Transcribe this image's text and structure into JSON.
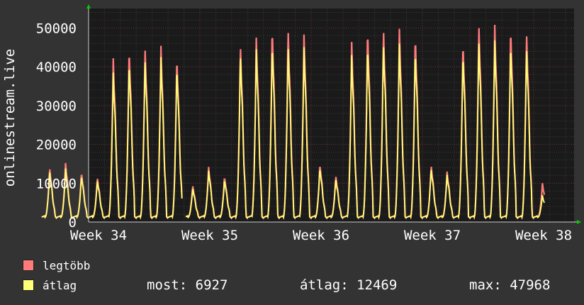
{
  "chart_data": {
    "type": "line",
    "ylabel": "onlinestream.live",
    "ylim": [
      0,
      55000
    ],
    "y_ticks": [
      0,
      10000,
      20000,
      30000,
      40000,
      50000
    ],
    "x_ticks": [
      "Week 34",
      "Week 35",
      "Week 36",
      "Week 37",
      "Week 38"
    ],
    "grid": true,
    "days": 35,
    "series": [
      {
        "name": "legtöbb",
        "color": "#ff7b7b",
        "daily_peaks": [
          14000,
          15200,
          12800,
          11500,
          42200,
          45200,
          45600,
          45400,
          43000,
          9500,
          14200,
          11800,
          46000,
          47500,
          50600,
          50300,
          48300,
          15000,
          12000,
          46400,
          50200,
          50300,
          49800,
          48600,
          14700,
          13000,
          47000,
          51600,
          50800,
          50700,
          49400,
          10000
        ]
      },
      {
        "name": "átlag",
        "color": "#ffff77",
        "daily_peaks": [
          13200,
          13800,
          12000,
          10800,
          38500,
          41800,
          42500,
          42500,
          40500,
          8800,
          13200,
          11000,
          43500,
          44500,
          46500,
          46000,
          45000,
          14000,
          11200,
          43000,
          46000,
          46500,
          46000,
          44800,
          13800,
          12200,
          44000,
          47500,
          46800,
          46500,
          45500,
          6927
        ]
      }
    ]
  },
  "legend": {
    "max_label": "legtöbb",
    "avg_label": "átlag",
    "now_text": "most: 6927",
    "avg_text": "átlag: 12469",
    "max_text": "max: 47968",
    "max_color": "#ff7b7b",
    "avg_color": "#ffff77"
  }
}
